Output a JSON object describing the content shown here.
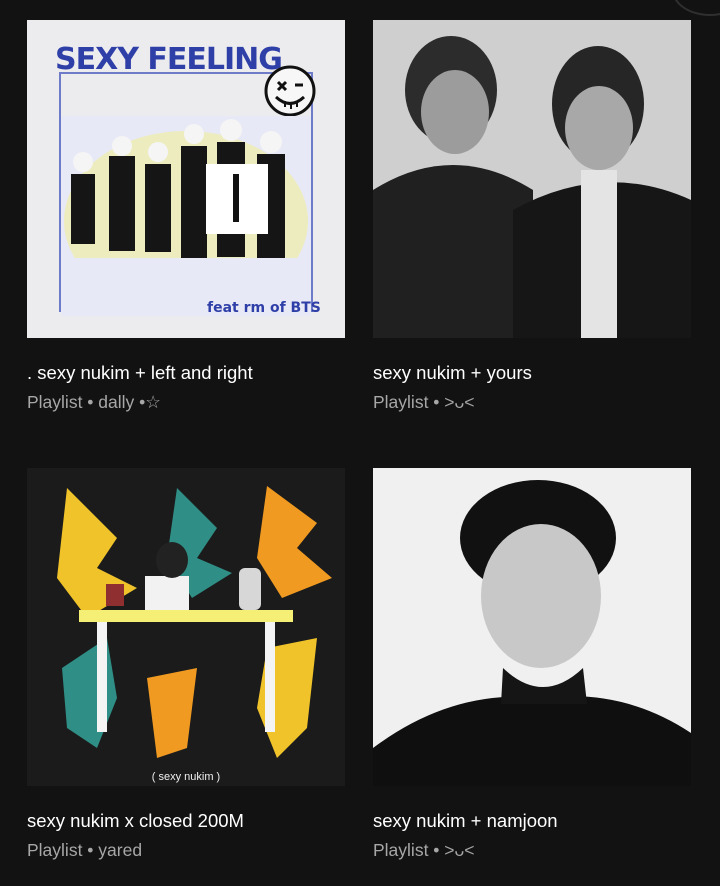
{
  "playlists": [
    {
      "title": ". sexy nukim + left and right",
      "subtitle": "Playlist • dally •☆",
      "cover_text": {
        "headline": "SEXY FEELING",
        "credit": "feat rm of BTS"
      }
    },
    {
      "title": "sexy nukim + yours",
      "subtitle": "Playlist • >ᴗ<"
    },
    {
      "title": "sexy nukim x closed 200M",
      "subtitle": "Playlist • yared",
      "cover_text": {
        "tag": "( sexy nukim )"
      }
    },
    {
      "title": "sexy nukim + namjoon",
      "subtitle": "Playlist • >ᴗ<"
    }
  ]
}
